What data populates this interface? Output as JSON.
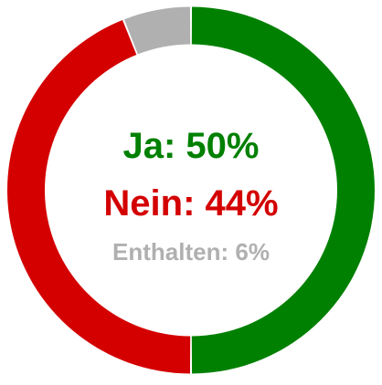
{
  "chart_data": {
    "type": "pie",
    "donut": true,
    "slices": [
      {
        "label": "Ja",
        "value": 50,
        "display": "Ja: 50%",
        "color": "#008000"
      },
      {
        "label": "Nein",
        "value": 44,
        "display": "Nein: 44%",
        "color": "#d40000"
      },
      {
        "label": "Enthalten",
        "value": 6,
        "display": "Enthalten: 6%",
        "color": "#b0b0b0"
      }
    ],
    "unit": "%"
  }
}
